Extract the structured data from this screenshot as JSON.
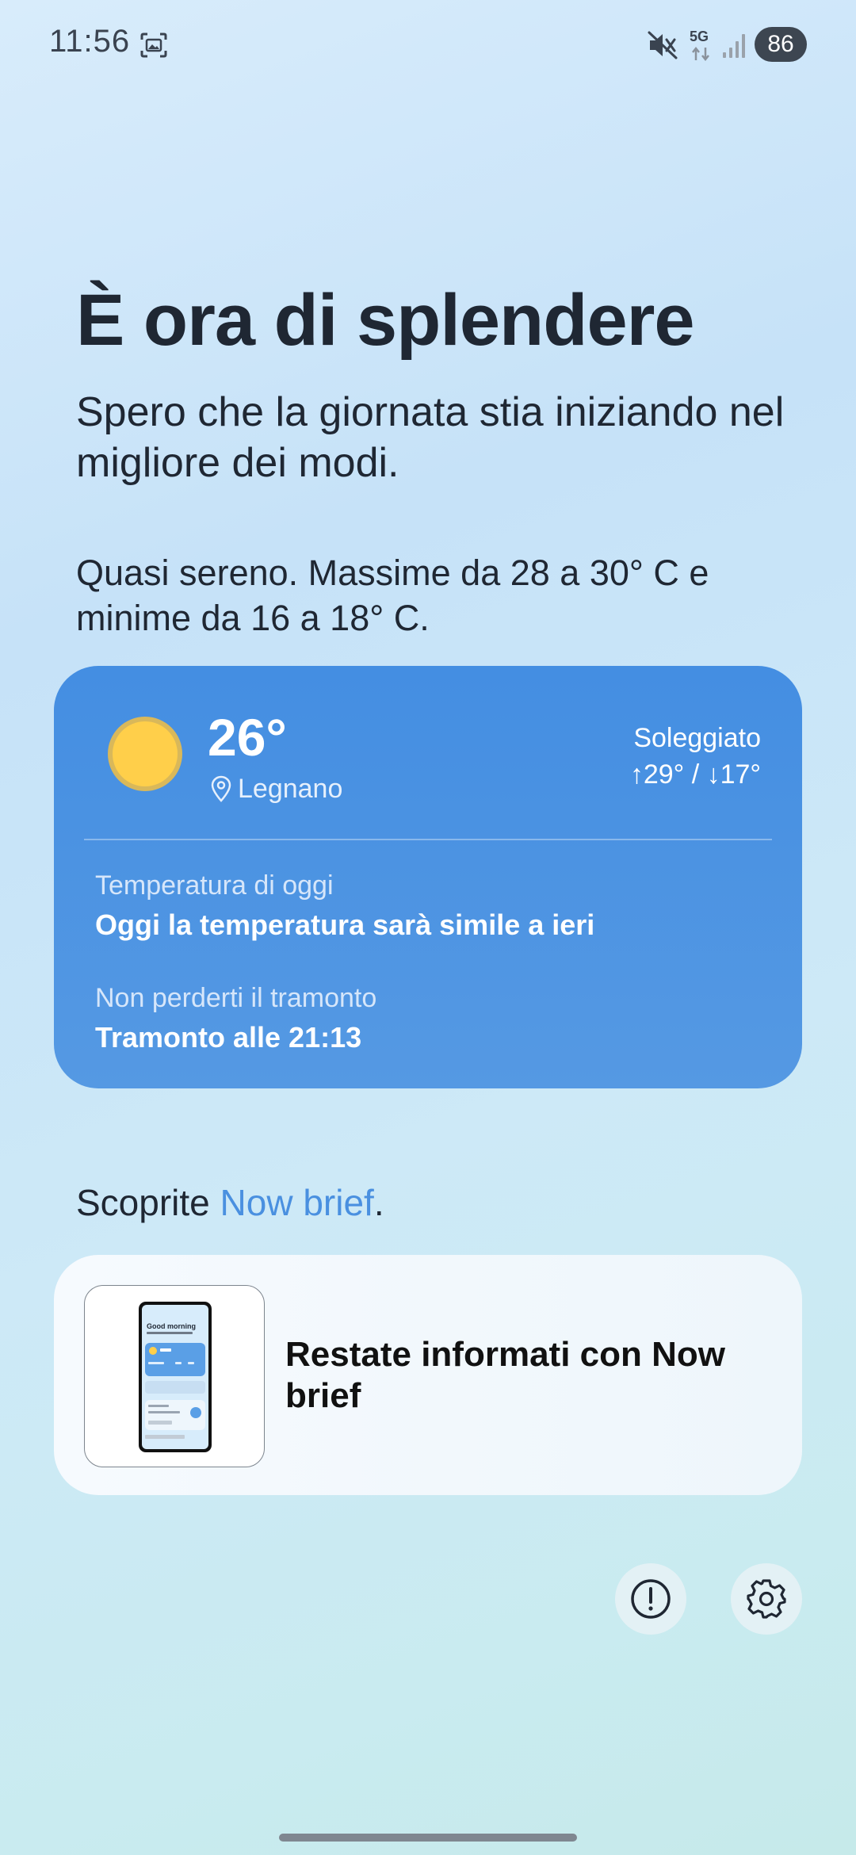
{
  "status_bar": {
    "time": "11:56",
    "network": "5G",
    "battery": "86",
    "icons": [
      "screenshot-icon",
      "mute-icon",
      "network-5g-icon",
      "signal-icon",
      "battery-icon"
    ]
  },
  "greeting": {
    "title": "È ora di splendere",
    "subtitle": "Spero che la giornata stia iniziando nel migliore dei modi.",
    "forecast": "Quasi sereno. Massime da 28 a 30° C e minime da 16 a 18° C."
  },
  "weather_card": {
    "temperature": "26°",
    "location": "Legnano",
    "condition": "Soleggiato",
    "high_low": "↑29° / ↓17°",
    "today_label": "Temperatura di oggi",
    "today_value": "Oggi la temperatura sarà simile a ieri",
    "sunset_label": "Non perderti il tramonto",
    "sunset_value": "Tramonto alle 21:13",
    "colors": {
      "card": "#448ee2",
      "sun": "#ffcf4a"
    },
    "icons": [
      "sun-icon",
      "location-pin-icon"
    ]
  },
  "discover": {
    "prefix": "Scoprite ",
    "link": "Now brief",
    "suffix": ".",
    "link_color": "#4a90e0"
  },
  "promo_card": {
    "title": "Restate informati con Now brief",
    "thumb_greeting": "Good morning"
  },
  "actions": {
    "icons": [
      "info-icon",
      "gear-icon"
    ]
  }
}
